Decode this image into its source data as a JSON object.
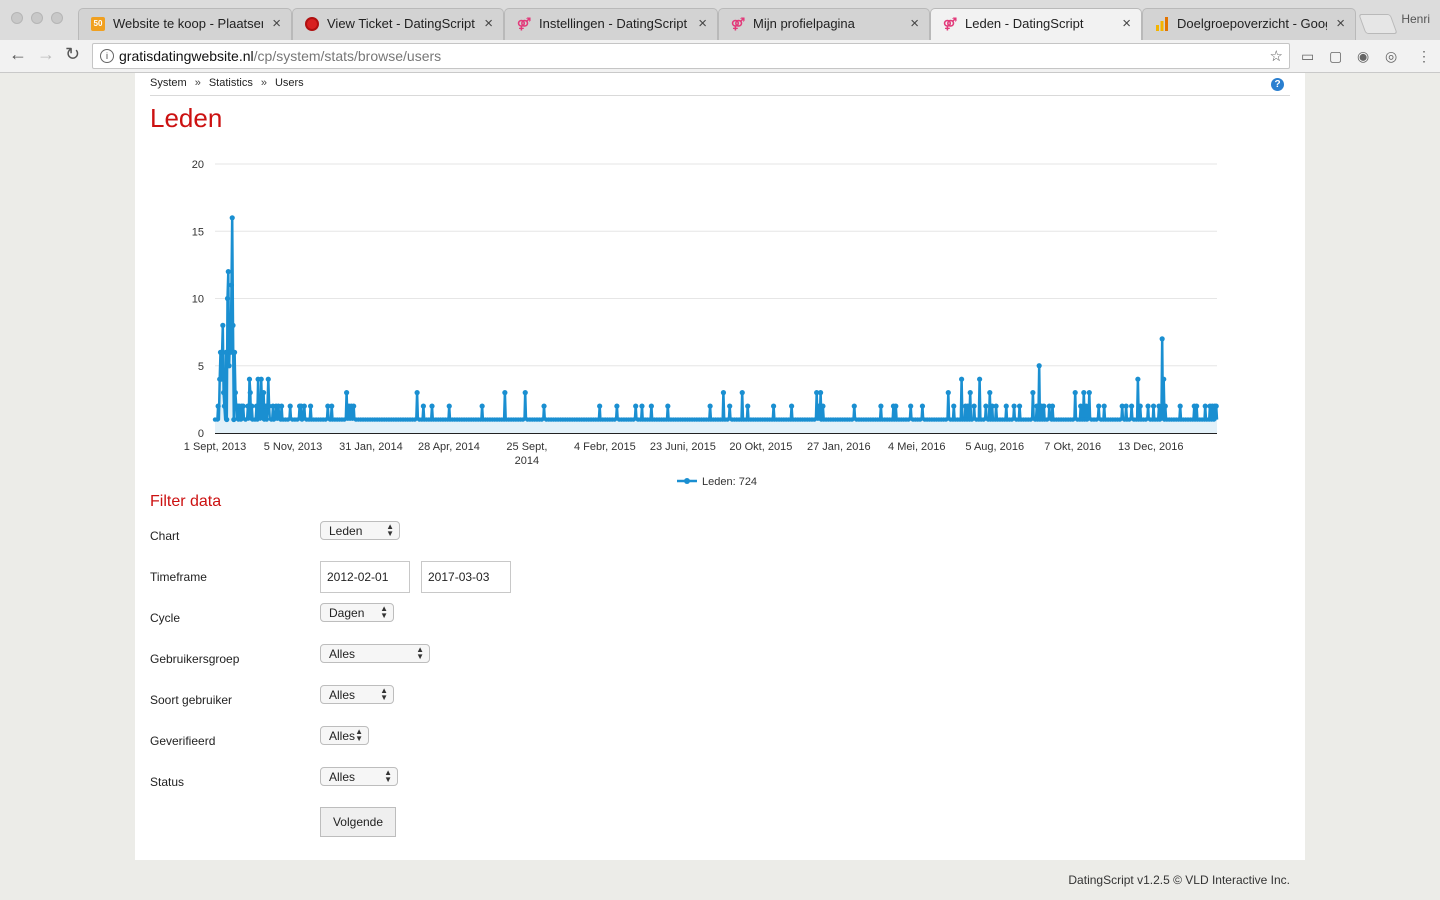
{
  "browser": {
    "tabs": [
      {
        "title": "Website te koop - Plaatsen",
        "icon": "site-icon"
      },
      {
        "title": "View Ticket - DatingScript",
        "icon": "ticket-icon"
      },
      {
        "title": "Instellingen - DatingScript",
        "icon": "datingscript-icon"
      },
      {
        "title": "Mijn profielpagina",
        "icon": "datingscript-icon"
      },
      {
        "title": "Leden - DatingScript",
        "icon": "datingscript-icon",
        "active": true
      },
      {
        "title": "Doelgroepoverzicht - Googl",
        "icon": "analytics-icon"
      }
    ],
    "user": "Henri",
    "url_domain": "gratisdatingwebsite.nl",
    "url_path": "/cp/system/stats/browse/users"
  },
  "breadcrumb": {
    "items": [
      "System",
      "Statistics",
      "Users"
    ],
    "separator": "»"
  },
  "page_title": "Leden",
  "chart_data": {
    "type": "line",
    "title": "",
    "xlabel": "",
    "ylabel": "",
    "ylim": [
      0,
      20
    ],
    "y_ticks": [
      0,
      5,
      10,
      15,
      20
    ],
    "x_range": [
      "2013-09-01",
      "2017-03-03"
    ],
    "x_tick_labels": [
      "1 Sept, 2013",
      "5 Nov, 2013",
      "31 Jan, 2014",
      "28 Apr, 2014",
      "25 Sept, 2014",
      "4 Febr, 2015",
      "23 Juni, 2015",
      "20 Okt, 2015",
      "27 Jan, 2016",
      "4 Mei, 2016",
      "5 Aug, 2016",
      "7 Okt, 2016",
      "13 Dec, 2016"
    ],
    "legend": "bottom-center",
    "grid": true,
    "baseline": 1,
    "series": [
      {
        "name": "Leden: 724",
        "color": "#1a8fd1",
        "points": [
          {
            "x": "2013-09-05",
            "y": 2
          },
          {
            "x": "2013-09-07",
            "y": 4
          },
          {
            "x": "2013-09-08",
            "y": 6
          },
          {
            "x": "2013-09-09",
            "y": 4
          },
          {
            "x": "2013-09-10",
            "y": 6
          },
          {
            "x": "2013-09-11",
            "y": 8
          },
          {
            "x": "2013-09-12",
            "y": 3
          },
          {
            "x": "2013-09-13",
            "y": 2
          },
          {
            "x": "2013-09-15",
            "y": 6
          },
          {
            "x": "2013-09-16",
            "y": 1
          },
          {
            "x": "2013-09-17",
            "y": 10
          },
          {
            "x": "2013-09-18",
            "y": 12
          },
          {
            "x": "2013-09-19",
            "y": 5
          },
          {
            "x": "2013-09-20",
            "y": 7
          },
          {
            "x": "2013-09-21",
            "y": 6
          },
          {
            "x": "2013-09-22",
            "y": 11
          },
          {
            "x": "2013-09-23",
            "y": 16
          },
          {
            "x": "2013-09-24",
            "y": 8
          },
          {
            "x": "2013-09-25",
            "y": 1
          },
          {
            "x": "2013-09-26",
            "y": 6
          },
          {
            "x": "2013-09-27",
            "y": 3
          },
          {
            "x": "2013-09-28",
            "y": 2
          },
          {
            "x": "2013-09-30",
            "y": 2
          },
          {
            "x": "2013-10-02",
            "y": 2
          },
          {
            "x": "2013-10-05",
            "y": 2
          },
          {
            "x": "2013-10-07",
            "y": 2
          },
          {
            "x": "2013-10-13",
            "y": 2
          },
          {
            "x": "2013-10-15",
            "y": 4
          },
          {
            "x": "2013-10-16",
            "y": 3
          },
          {
            "x": "2013-10-18",
            "y": 2
          },
          {
            "x": "2013-10-24",
            "y": 2
          },
          {
            "x": "2013-10-26",
            "y": 4
          },
          {
            "x": "2013-10-28",
            "y": 2
          },
          {
            "x": "2013-10-30",
            "y": 4
          },
          {
            "x": "2013-10-31",
            "y": 2
          },
          {
            "x": "2013-11-02",
            "y": 3
          },
          {
            "x": "2013-11-05",
            "y": 2
          },
          {
            "x": "2013-11-07",
            "y": 2
          },
          {
            "x": "2013-11-08",
            "y": 4
          },
          {
            "x": "2013-11-09",
            "y": 2
          },
          {
            "x": "2013-11-14",
            "y": 2
          },
          {
            "x": "2013-11-18",
            "y": 2
          },
          {
            "x": "2013-11-21",
            "y": 2
          },
          {
            "x": "2013-11-25",
            "y": 2
          },
          {
            "x": "2013-12-06",
            "y": 2
          },
          {
            "x": "2013-12-18",
            "y": 2
          },
          {
            "x": "2013-12-20",
            "y": 2
          },
          {
            "x": "2013-12-24",
            "y": 2
          },
          {
            "x": "2014-01-01",
            "y": 2
          },
          {
            "x": "2014-01-23",
            "y": 2
          },
          {
            "x": "2014-01-28",
            "y": 2
          },
          {
            "x": "2014-02-16",
            "y": 3
          },
          {
            "x": "2014-02-19",
            "y": 2
          },
          {
            "x": "2014-02-22",
            "y": 2
          },
          {
            "x": "2014-02-25",
            "y": 2
          },
          {
            "x": "2014-05-17",
            "y": 3
          },
          {
            "x": "2014-05-25",
            "y": 2
          },
          {
            "x": "2014-06-05",
            "y": 2
          },
          {
            "x": "2014-06-27",
            "y": 2
          },
          {
            "x": "2014-08-08",
            "y": 2
          },
          {
            "x": "2014-09-06",
            "y": 3
          },
          {
            "x": "2014-10-02",
            "y": 3
          },
          {
            "x": "2014-10-26",
            "y": 2
          },
          {
            "x": "2015-01-05",
            "y": 2
          },
          {
            "x": "2015-01-27",
            "y": 2
          },
          {
            "x": "2015-02-20",
            "y": 2
          },
          {
            "x": "2015-02-28",
            "y": 2
          },
          {
            "x": "2015-03-12",
            "y": 2
          },
          {
            "x": "2015-04-02",
            "y": 2
          },
          {
            "x": "2015-05-26",
            "y": 2
          },
          {
            "x": "2015-06-12",
            "y": 3
          },
          {
            "x": "2015-06-20",
            "y": 2
          },
          {
            "x": "2015-07-06",
            "y": 3
          },
          {
            "x": "2015-07-13",
            "y": 2
          },
          {
            "x": "2015-08-15",
            "y": 2
          },
          {
            "x": "2015-09-07",
            "y": 2
          },
          {
            "x": "2015-10-09",
            "y": 3
          },
          {
            "x": "2015-10-12",
            "y": 2
          },
          {
            "x": "2015-10-14",
            "y": 3
          },
          {
            "x": "2015-10-17",
            "y": 2
          },
          {
            "x": "2015-11-26",
            "y": 2
          },
          {
            "x": "2015-12-30",
            "y": 2
          },
          {
            "x": "2016-01-15",
            "y": 2
          },
          {
            "x": "2016-01-18",
            "y": 2
          },
          {
            "x": "2016-02-06",
            "y": 2
          },
          {
            "x": "2016-02-21",
            "y": 2
          },
          {
            "x": "2016-03-25",
            "y": 3
          },
          {
            "x": "2016-04-01",
            "y": 2
          },
          {
            "x": "2016-04-11",
            "y": 4
          },
          {
            "x": "2016-04-16",
            "y": 2
          },
          {
            "x": "2016-04-19",
            "y": 2
          },
          {
            "x": "2016-04-22",
            "y": 3
          },
          {
            "x": "2016-04-27",
            "y": 2
          },
          {
            "x": "2016-05-04",
            "y": 4
          },
          {
            "x": "2016-05-12",
            "y": 2
          },
          {
            "x": "2016-05-17",
            "y": 3
          },
          {
            "x": "2016-05-20",
            "y": 2
          },
          {
            "x": "2016-05-25",
            "y": 2
          },
          {
            "x": "2016-06-07",
            "y": 2
          },
          {
            "x": "2016-06-17",
            "y": 2
          },
          {
            "x": "2016-06-24",
            "y": 2
          },
          {
            "x": "2016-07-11",
            "y": 3
          },
          {
            "x": "2016-07-16",
            "y": 2
          },
          {
            "x": "2016-07-19",
            "y": 5
          },
          {
            "x": "2016-07-22",
            "y": 2
          },
          {
            "x": "2016-07-25",
            "y": 2
          },
          {
            "x": "2016-08-01",
            "y": 2
          },
          {
            "x": "2016-08-05",
            "y": 2
          },
          {
            "x": "2016-09-03",
            "y": 3
          },
          {
            "x": "2016-09-10",
            "y": 2
          },
          {
            "x": "2016-09-14",
            "y": 3
          },
          {
            "x": "2016-09-17",
            "y": 2
          },
          {
            "x": "2016-09-21",
            "y": 3
          },
          {
            "x": "2016-10-03",
            "y": 2
          },
          {
            "x": "2016-10-10",
            "y": 2
          },
          {
            "x": "2016-11-02",
            "y": 2
          },
          {
            "x": "2016-11-07",
            "y": 2
          },
          {
            "x": "2016-11-14",
            "y": 2
          },
          {
            "x": "2016-11-22",
            "y": 4
          },
          {
            "x": "2016-11-25",
            "y": 2
          },
          {
            "x": "2016-12-05",
            "y": 2
          },
          {
            "x": "2016-12-12",
            "y": 2
          },
          {
            "x": "2016-12-19",
            "y": 2
          },
          {
            "x": "2016-12-23",
            "y": 7
          },
          {
            "x": "2016-12-25",
            "y": 4
          },
          {
            "x": "2016-12-27",
            "y": 2
          },
          {
            "x": "2017-01-15",
            "y": 2
          },
          {
            "x": "2017-02-02",
            "y": 2
          },
          {
            "x": "2017-02-05",
            "y": 2
          },
          {
            "x": "2017-02-16",
            "y": 2
          },
          {
            "x": "2017-02-22",
            "y": 2
          },
          {
            "x": "2017-02-25",
            "y": 2
          },
          {
            "x": "2017-02-28",
            "y": 2
          },
          {
            "x": "2017-03-02",
            "y": 2
          }
        ]
      }
    ]
  },
  "filter": {
    "title": "Filter data",
    "chart_label": "Chart",
    "chart_value": "Leden",
    "timeframe_label": "Timeframe",
    "timeframe_from": "2012-02-01",
    "timeframe_to": "2017-03-03",
    "cycle_label": "Cycle",
    "cycle_value": "Dagen",
    "group_label": "Gebruikersgroep",
    "group_value": "Alles",
    "type_label": "Soort gebruiker",
    "type_value": "Alles",
    "verified_label": "Geverifieerd",
    "verified_value": "Alles",
    "status_label": "Status",
    "status_value": "Alles",
    "submit_label": "Volgende"
  },
  "footer": "DatingScript v1.2.5 © VLD Interactive Inc."
}
